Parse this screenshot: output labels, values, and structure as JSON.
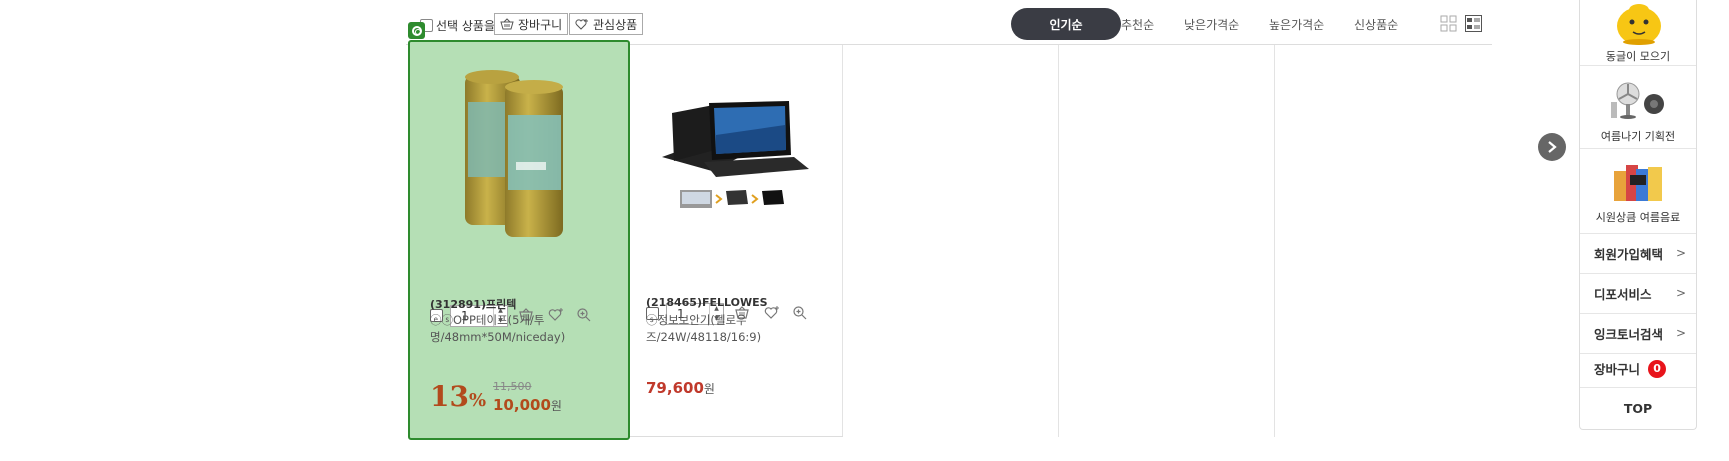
{
  "toolbar": {
    "select_label": "선택 상품을",
    "cart_button": "장바구니",
    "wish_button": "관심상품",
    "sort_options": [
      "인기순",
      "추천순",
      "낮은가격순",
      "높은가격순",
      "신상품순"
    ],
    "active_sort": "인기순"
  },
  "products": [
    {
      "code": "(312891)프린텍",
      "name": "ⓔⓢOPP테이프(5개/투명/48mm*50M/niceday)",
      "qty": "1",
      "discount": "13",
      "discount_unit": "%",
      "original_price": "11,500",
      "price": "10,000",
      "currency": "원",
      "selected": true
    },
    {
      "code": "(218465)FELLOWES",
      "name": "ⓢ정보보안기(펠로우즈/24W/48118/16:9)",
      "qty": "1",
      "price": "79,600",
      "currency": "원",
      "selected": false
    }
  ],
  "quick_menu": {
    "items": [
      {
        "label": "동글이 모으기",
        "icon": "mascot-icon"
      },
      {
        "label": "여름나기 기획전",
        "icon": "fan-icon"
      },
      {
        "label": "시원상큼 여름음료",
        "icon": "drinks-icon"
      }
    ],
    "links": [
      {
        "label": "회원가입혜택"
      },
      {
        "label": "디포서비스"
      },
      {
        "label": "잉크토너검색"
      }
    ],
    "cart_label": "장바구니",
    "cart_count": "0",
    "top_label": "TOP"
  },
  "colors": {
    "selected_bg": "#b5dfb5",
    "selected_border": "#2e8b2e",
    "price_accent": "#b24a1c",
    "badge_red": "#e8141b",
    "active_sort_bg": "#3a3c44"
  }
}
